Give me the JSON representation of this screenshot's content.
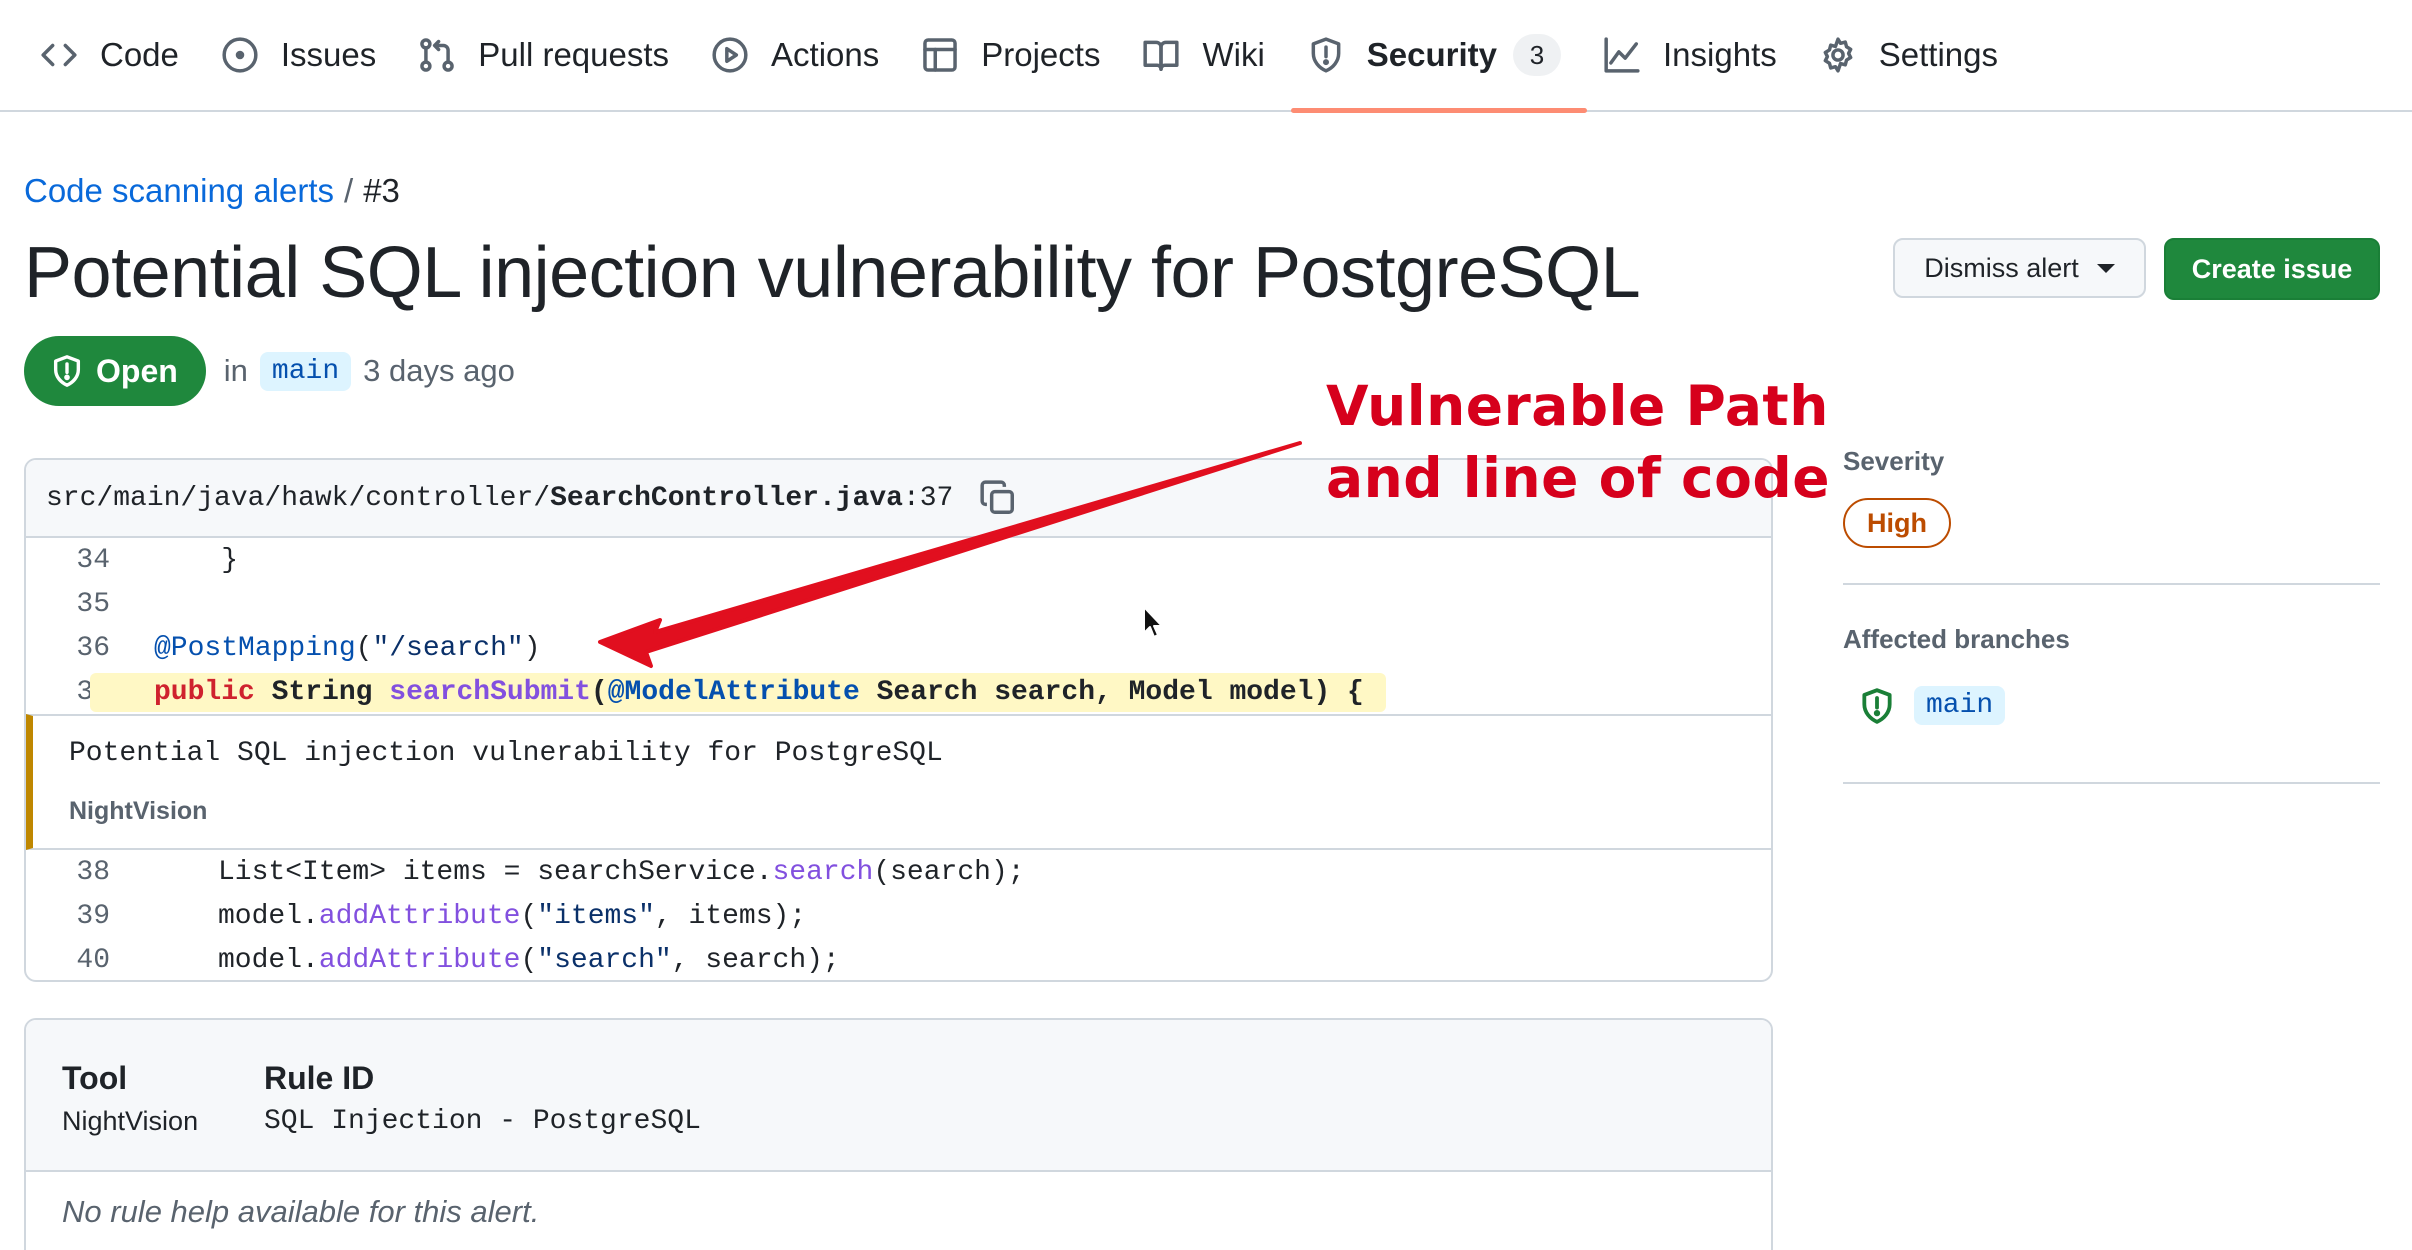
{
  "nav": {
    "tabs": [
      {
        "label": "Code",
        "icon": "code-icon"
      },
      {
        "label": "Issues",
        "icon": "issue-circle-icon"
      },
      {
        "label": "Pull requests",
        "icon": "pull-request-icon"
      },
      {
        "label": "Actions",
        "icon": "play-icon"
      },
      {
        "label": "Projects",
        "icon": "table-icon"
      },
      {
        "label": "Wiki",
        "icon": "book-icon"
      },
      {
        "label": "Security",
        "icon": "shield-icon",
        "counter": "3",
        "active": true
      },
      {
        "label": "Insights",
        "icon": "graph-icon"
      },
      {
        "label": "Settings",
        "icon": "gear-icon"
      }
    ]
  },
  "breadcrumb": {
    "link": "Code scanning alerts",
    "separator": "/",
    "current": "#3"
  },
  "alert": {
    "title": "Potential SQL injection vulnerability for PostgreSQL",
    "state": "Open",
    "in_label": "in",
    "branch": "main",
    "age": "3 days ago"
  },
  "actions": {
    "dismiss_label": "Dismiss alert",
    "create_label": "Create issue"
  },
  "code": {
    "path_prefix": "src/main/java/hawk/controller/",
    "file": "SearchController.java",
    "line_suffix": ":37",
    "lines_before": [
      {
        "num": "34",
        "text": "    }"
      },
      {
        "num": "35",
        "text": ""
      },
      {
        "num": "36",
        "text": "@PostMapping(\"/search\")"
      },
      {
        "num": "37",
        "text": "public String searchSubmit(@ModelAttribute Search search, Model model) {"
      }
    ],
    "alert_message": "Potential SQL injection vulnerability for PostgreSQL",
    "alert_tool": "NightVision",
    "lines_after": [
      {
        "num": "38",
        "text": "List<Item> items = searchService.search(search);"
      },
      {
        "num": "39",
        "text": "model.addAttribute(\"items\", items);"
      },
      {
        "num": "40",
        "text": "model.addAttribute(\"search\", search);"
      }
    ]
  },
  "details": {
    "tool_header": "Tool",
    "tool_value": "NightVision",
    "rule_header": "Rule ID",
    "rule_value": "SQL Injection - PostgreSQL",
    "help_text": "No rule help available for this alert."
  },
  "sidebar": {
    "severity_label": "Severity",
    "severity_value": "High",
    "affected_label": "Affected branches",
    "affected_branch": "main"
  },
  "annotation": {
    "line1": "Vulnerable Path",
    "line2": "and line of code",
    "color": "#d6001c"
  }
}
